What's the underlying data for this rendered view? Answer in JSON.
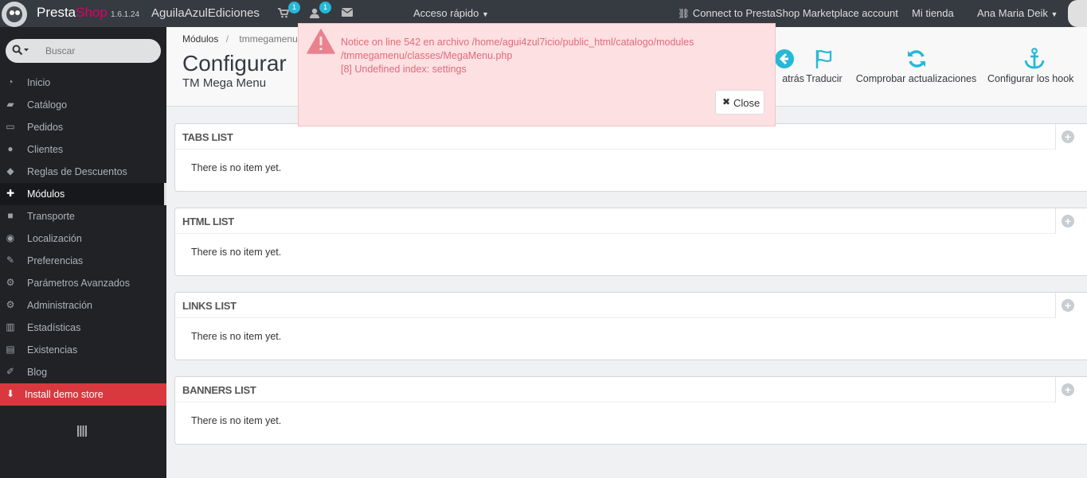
{
  "header": {
    "brand_presta": "Presta",
    "brand_shop": "Shop",
    "version": "1.6.1.24",
    "shop_name": "AguilaAzulEdiciones",
    "orders_badge": "1",
    "customers_badge": "1",
    "quick_access": "Acceso rápido",
    "connect": "Connect to PrestaShop Marketplace account",
    "my_store": "Mi tienda",
    "user_name": "Ana Maria Deik"
  },
  "sidebar": {
    "search_placeholder": "Buscar",
    "items": [
      {
        "label": "Inicio",
        "icon": "dashboard-icon"
      },
      {
        "label": "Catálogo",
        "icon": "book-icon"
      },
      {
        "label": "Pedidos",
        "icon": "credit-card-icon"
      },
      {
        "label": "Clientes",
        "icon": "users-icon"
      },
      {
        "label": "Reglas de Descuentos",
        "icon": "tags-icon"
      },
      {
        "label": "Módulos",
        "icon": "puzzle-icon"
      },
      {
        "label": "Transporte",
        "icon": "truck-icon"
      },
      {
        "label": "Localización",
        "icon": "globe-icon"
      },
      {
        "label": "Preferencias",
        "icon": "wrench-icon"
      },
      {
        "label": "Parámetros Avanzados",
        "icon": "cogs-icon"
      },
      {
        "label": "Administración",
        "icon": "cog-icon"
      },
      {
        "label": "Estadísticas",
        "icon": "bar-chart-icon"
      },
      {
        "label": "Existencias",
        "icon": "archive-icon"
      },
      {
        "label": "Blog",
        "icon": "edit-icon"
      },
      {
        "label": "Install demo store",
        "icon": "download-icon"
      }
    ],
    "active_item": "Módulos"
  },
  "page": {
    "breadcrumb_root": "Módulos",
    "breadcrumb_current": "tmmegamenu",
    "title": "Configurar",
    "subtitle": "TM Mega Menu",
    "toolbar": [
      {
        "label": "atrás",
        "icon": "arrow-left-circle-icon"
      },
      {
        "label": "Traducir",
        "icon": "flag-icon"
      },
      {
        "label": "Comprobar actualizaciones",
        "icon": "refresh-icon"
      },
      {
        "label": "Configurar los hook",
        "icon": "anchor-icon"
      }
    ]
  },
  "panels": [
    {
      "title": "TABS LIST",
      "empty": "There is no item yet."
    },
    {
      "title": "HTML LIST",
      "empty": "There is no item yet."
    },
    {
      "title": "LINKS LIST",
      "empty": "There is no item yet."
    },
    {
      "title": "BANNERS LIST",
      "empty": "There is no item yet."
    }
  ],
  "notice": {
    "line1": "Notice on line 542 en archivo /home/agui4zul7icio/public_html/catalogo/modules",
    "line2": "/tmmegamenu/classes/MegaMenu.php",
    "line3": "[8] Undefined index: settings",
    "close_label": "Close"
  },
  "colors": {
    "header_bg": "#363a41",
    "sidebar_bg": "#202226",
    "accent": "#25b9d7",
    "brand_pink": "#df0067",
    "notice_bg": "#fde0e2",
    "notice_text": "#e06b79",
    "demo_red": "#d9383f"
  }
}
